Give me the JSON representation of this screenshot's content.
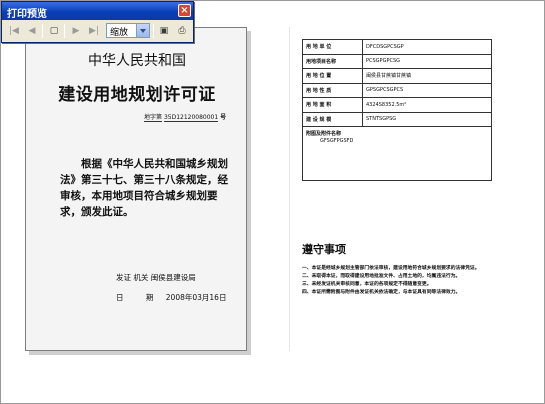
{
  "toolbar": {
    "title": "打印预览",
    "close_glyph": "×",
    "zoom_value": "缩放",
    "buttons": [
      {
        "name": "first-page-icon",
        "glyph": "|◀"
      },
      {
        "name": "prev-page-icon",
        "glyph": "◀"
      },
      {
        "name": "copy-page-icon",
        "glyph": "▢"
      },
      {
        "name": "next-page-icon",
        "glyph": "▶"
      },
      {
        "name": "last-page-icon",
        "glyph": "▶|"
      },
      {
        "name": "page-setup-icon",
        "glyph": "▣"
      },
      {
        "name": "print-icon",
        "glyph": "⎙"
      }
    ]
  },
  "permit": {
    "country": "中华人民共和国",
    "title": "建设用地规划许可证",
    "number_label": "地字第",
    "number_value": "35D12120080001",
    "number_suffix": "号",
    "body": "根据《中华人民共和国城乡规划法》第三十七、第三十八条规定，经审核，本用地项目符合城乡规划要求，颁发此证。",
    "issuer_label": "发证 机关",
    "issuer_value": "闽侯县建设局",
    "date_label": "日 期",
    "date_value": "2008年03月16日"
  },
  "details": {
    "rows": [
      {
        "label": "用 地 单 位",
        "value": "DFCDSGPCSGP"
      },
      {
        "label": "用地项目名称",
        "value": "PCSGPGPCSG"
      },
      {
        "label": "用 地 位 置",
        "value": "闽侯县甘蔗镇甘蔗镇"
      },
      {
        "label": "用 地 性 质",
        "value": "GPSGPCSGPCS"
      },
      {
        "label": "用 地 面 积",
        "value": "4324S8352.5m²"
      },
      {
        "label": "建 设 规 模",
        "value": "STNTSGPSG"
      }
    ],
    "attachment_label": "附图及附件名称",
    "attachment_value": "GFSGFPGSFD",
    "notes_title": "遵守事项",
    "notes": [
      "一、本证是经城乡规划主管部门依法审核，建设用地符合城乡规划要求的法律凭证。",
      "二、未取得本证，而取得建设用地批准文件、占用土地的，均属违法行为。",
      "三、未经发证机关审核同意，本证的各项规定不得随意变更。",
      "四、本证所需附图与附件由发证机关依法确定，与本证具有同等法律效力。"
    ]
  }
}
